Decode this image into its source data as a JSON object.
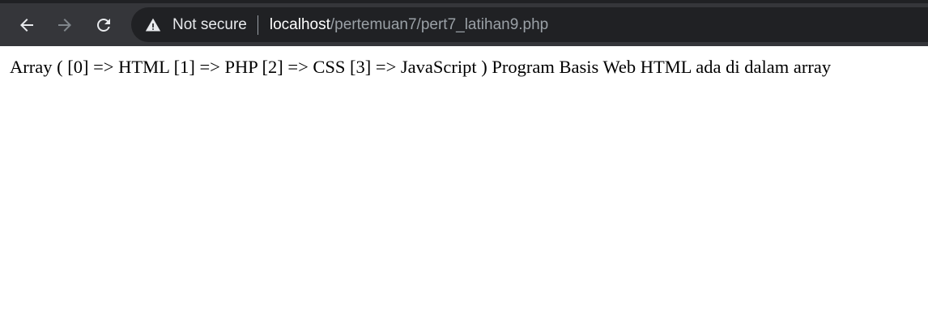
{
  "browser": {
    "back_icon": "arrow-left-icon",
    "forward_icon": "arrow-right-icon",
    "reload_icon": "reload-icon",
    "security_icon": "warning-triangle-icon",
    "security_label": "Not secure",
    "url_host": "localhost",
    "url_path": "/pertemuan7/pert7_latihan9.php",
    "colors": {
      "toolbar": "#35363a",
      "top_strip": "#202124",
      "omnibox": "#202124",
      "host_text": "#ffffff",
      "path_text": "#9aa0a6",
      "forward_disabled": "#80868b"
    }
  },
  "page": {
    "output_text": "Array ( [0] => HTML [1] => PHP [2] => CSS [3] => JavaScript ) Program Basis Web HTML ada di dalam array"
  }
}
